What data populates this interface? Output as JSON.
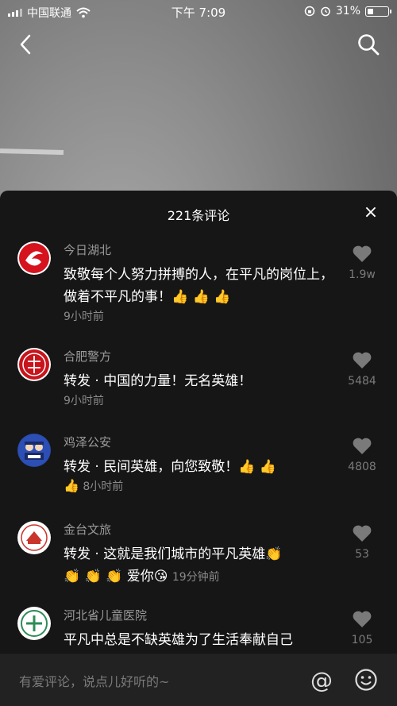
{
  "status": {
    "carrier": "中国联通",
    "time": "下午 7:09",
    "battery": "31%"
  },
  "comments_panel": {
    "title": "221条评论",
    "close": "×"
  },
  "comments": [
    {
      "user": "今日湖北",
      "text": "致敬每个人努力拼搏的人，在平凡的岗位上，做着不平凡的事！👍 👍 👍",
      "time": "9小时前",
      "likes": "1.9w"
    },
    {
      "user": "合肥警方",
      "text": "转发 · 中国的力量！无名英雄！",
      "time": "9小时前",
      "likes": "5484"
    },
    {
      "user": "鸡泽公安",
      "text": "转发 · 民间英雄，向您致敬！👍 👍",
      "emoji_time": "👍",
      "time": "8小时前",
      "likes": "4808"
    },
    {
      "user": "金台文旅",
      "text": "转发 · 这就是我们城市的平凡英雄👏",
      "text_line2": "👏 👏 👏 爱你😘",
      "time": "19分钟前",
      "likes": "53"
    },
    {
      "user": "河北省儿童医院",
      "text": "平凡中总是不缺英雄为了生活奉献自己",
      "likes": "105"
    }
  ],
  "input": {
    "placeholder": "有爱评论，说点儿好听的~",
    "at": "@"
  }
}
